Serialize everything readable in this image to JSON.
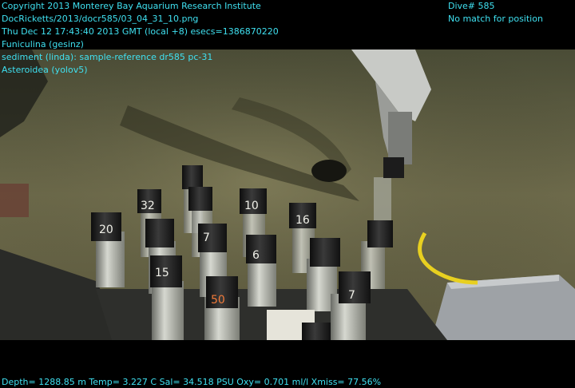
{
  "overlay": {
    "header_left": [
      "Copyright 2013 Monterey Bay Aquarium Research Institute",
      "DocRicketts/2013/docr585/03_04_31_10.png",
      "Thu Dec 12 17:43:40 2013 GMT (local +8)  esecs=1386870220",
      "Funiculina (gesinz)",
      "sediment (linda): sample-reference dr585 pc-31",
      "Asteroidea (yolov5)"
    ],
    "header_right": [
      "Dive# 585",
      "No match for position"
    ],
    "footer": "Depth= 1288.85 m  Temp= 3.227 C  Sal= 34.518 PSU  Oxy= 0.701 ml/l  Xmiss= 77.56%"
  },
  "cores": [
    {
      "label": "20"
    },
    {
      "label": "32"
    },
    {
      "label": "10"
    },
    {
      "label": "16"
    },
    {
      "label": "7"
    },
    {
      "label": "6"
    },
    {
      "label": "15"
    },
    {
      "label": "50"
    },
    {
      "label": "7"
    }
  ],
  "colors": {
    "text": "#3fe0f0",
    "seafloor": "#6e6b4a",
    "core_cap": "#1a1a1a",
    "tether": "#e8d020"
  }
}
